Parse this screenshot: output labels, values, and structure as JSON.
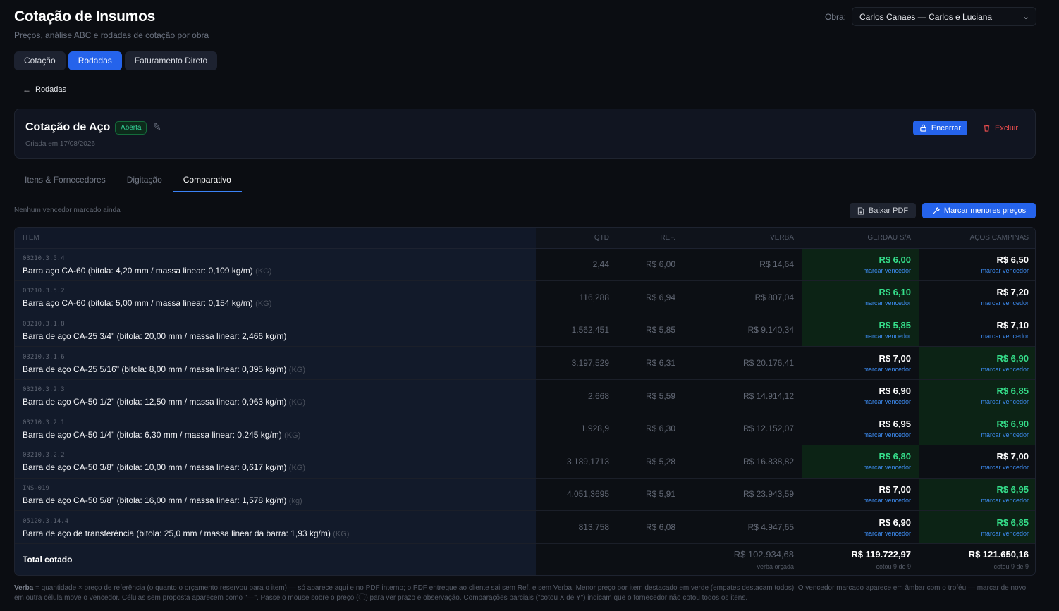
{
  "header": {
    "title": "Cotação de Insumos",
    "subtitle": "Preços, análise ABC e rodadas de cotação por obra",
    "obra_label": "Obra:",
    "obra_value": "Carlos Canaes — Carlos e Luciana"
  },
  "main_tabs": [
    "Cotação",
    "Rodadas",
    "Faturamento Direto"
  ],
  "back_label": "Rodadas",
  "round": {
    "title": "Cotação de Aço",
    "status": "Aberta",
    "created": "Criada em 17/08/2026",
    "close_label": "Encerrar",
    "delete_label": "Excluir"
  },
  "subtabs": [
    "Itens & Fornecedores",
    "Digitação",
    "Comparativo"
  ],
  "comparison": {
    "no_winner": "Nenhum vencedor marcado ainda",
    "pdf_label": "Baixar PDF",
    "mark_lowest_label": "Marcar menores preços",
    "columns": [
      "ITEM",
      "QTD",
      "REF.",
      "VERBA",
      "GERDAU S/A",
      "AÇOS CAMPINAS"
    ],
    "mark_winner": "marcar vencedor",
    "rows": [
      {
        "code": "03210.3.5.4",
        "desc": "Barra aço CA-60 (bitola: 4,20 mm / massa linear: 0,109 kg/m)",
        "unit": "(KG)",
        "qtd": "2,44",
        "ref": "R$ 6,00",
        "verba": "R$ 14,64",
        "p1": "R$ 6,00",
        "p2": "R$ 6,50",
        "best": 1
      },
      {
        "code": "03210.3.5.2",
        "desc": "Barra aço CA-60 (bitola: 5,00 mm / massa linear: 0,154 kg/m)",
        "unit": "(KG)",
        "qtd": "116,288",
        "ref": "R$ 6,94",
        "verba": "R$ 807,04",
        "p1": "R$ 6,10",
        "p2": "R$ 7,20",
        "best": 1
      },
      {
        "code": "03210.3.1.8",
        "desc": "Barra de aço CA-25 3/4\" (bitola: 20,00 mm / massa linear: 2,466 kg/m)",
        "unit": "",
        "qtd": "1.562,451",
        "ref": "R$ 5,85",
        "verba": "R$ 9.140,34",
        "p1": "R$ 5,85",
        "p2": "R$ 7,10",
        "best": 1
      },
      {
        "code": "03210.3.1.6",
        "desc": "Barra de aço CA-25 5/16\" (bitola: 8,00 mm / massa linear: 0,395 kg/m)",
        "unit": "(KG)",
        "qtd": "3.197,529",
        "ref": "R$ 6,31",
        "verba": "R$ 20.176,41",
        "p1": "R$ 7,00",
        "p2": "R$ 6,90",
        "best": 2
      },
      {
        "code": "03210.3.2.3",
        "desc": "Barra de aço CA-50 1/2\" (bitola: 12,50 mm / massa linear: 0,963 kg/m)",
        "unit": "(KG)",
        "qtd": "2.668",
        "ref": "R$ 5,59",
        "verba": "R$ 14.914,12",
        "p1": "R$ 6,90",
        "p2": "R$ 6,85",
        "best": 2
      },
      {
        "code": "03210.3.2.1",
        "desc": "Barra de aço CA-50 1/4\" (bitola: 6,30 mm / massa linear: 0,245 kg/m)",
        "unit": "(KG)",
        "qtd": "1.928,9",
        "ref": "R$ 6,30",
        "verba": "R$ 12.152,07",
        "p1": "R$ 6,95",
        "p2": "R$ 6,90",
        "best": 2
      },
      {
        "code": "03210.3.2.2",
        "desc": "Barra de aço CA-50 3/8\" (bitola: 10,00 mm / massa linear: 0,617 kg/m)",
        "unit": "(KG)",
        "qtd": "3.189,1713",
        "ref": "R$ 5,28",
        "verba": "R$ 16.838,82",
        "p1": "R$ 6,80",
        "p2": "R$ 7,00",
        "best": 1
      },
      {
        "code": "INS-019",
        "desc": "Barra de aço CA-50 5/8\" (bitola: 16,00 mm / massa linear: 1,578 kg/m)",
        "unit": "(kg)",
        "qtd": "4.051,3695",
        "ref": "R$ 5,91",
        "verba": "R$ 23.943,59",
        "p1": "R$ 7,00",
        "p2": "R$ 6,95",
        "best": 2
      },
      {
        "code": "05120.3.14.4",
        "desc": "Barra de aço de transferência (bitola: 25,0 mm / massa linear da barra: 1,93 kg/m)",
        "unit": "(KG)",
        "qtd": "813,758",
        "ref": "R$ 6,08",
        "verba": "R$ 4.947,65",
        "p1": "R$ 6,90",
        "p2": "R$ 6,85",
        "best": 2
      }
    ],
    "total": {
      "label": "Total cotado",
      "verba": "R$ 102.934,68",
      "verba_sub": "verba orçada",
      "p1": "R$ 119.722,97",
      "p1_sub": "cotou 9 de 9",
      "p2": "R$ 121.650,16",
      "p2_sub": "cotou 9 de 9"
    }
  },
  "footnote": {
    "term": "Verba",
    "text": " = quantidade × preço de referência (o quanto o orçamento reservou para o item) — só aparece aqui e no PDF interno; o PDF entregue ao cliente sai sem Ref. e sem Verba. Menor preço por item destacado em verde (empates destacam todos). O vencedor marcado aparece em âmbar com o troféu — marcar de novo em outra célula move o vencedor. Células sem proposta aparecem como \"—\". Passe o mouse sobre o preço (ⓘ) para ver prazo e observação. Comparações parciais (\"cotou X de Y\") indicam que o fornecedor não cotou todos os itens."
  },
  "colors": {
    "accent": "#2563eb",
    "best_bg": "#0c2315",
    "best_text": "#35de8a",
    "danger": "#f14f4f"
  },
  "icons": {
    "back": "arrow-left-icon",
    "edit": "pencil-icon",
    "lock": "lock-icon",
    "trash": "trash-icon",
    "pdf": "file-download-icon",
    "mark": "hammer-icon",
    "select": "chevron-down-icon"
  }
}
